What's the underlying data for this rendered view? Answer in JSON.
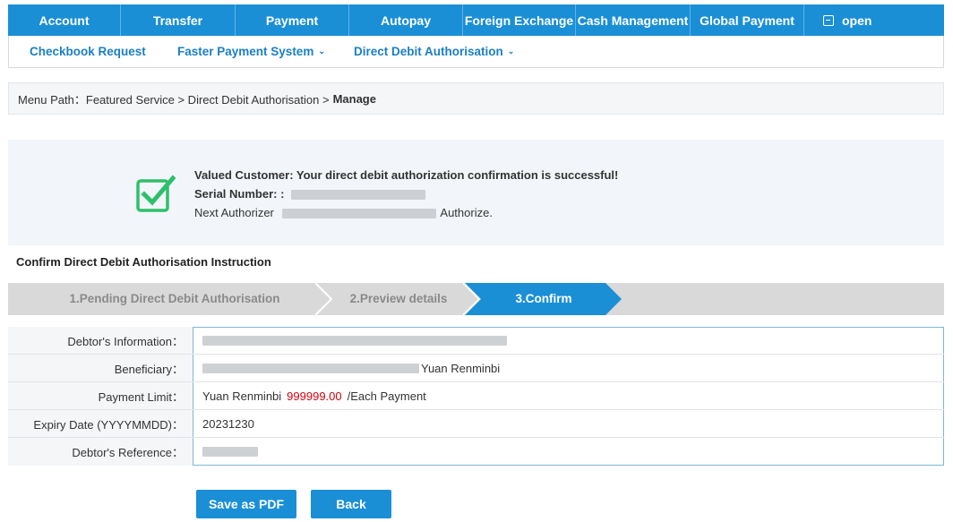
{
  "topnav": {
    "tabs": [
      "Account",
      "Transfer",
      "Payment",
      "Autopay",
      "Foreign Exchange",
      "Cash Management",
      "Global Payment"
    ],
    "open_label": "open"
  },
  "subnav": {
    "items": [
      "Checkbook Request",
      "Faster Payment System",
      "Direct Debit Authorisation"
    ]
  },
  "breadcrumb": {
    "prefix": "Menu Path：Featured Service > Direct Debit Authorisation >",
    "current": "Manage"
  },
  "success": {
    "message": "Valued Customer: Your direct debit authorization confirmation is successful!",
    "serial_label": "Serial Number: :",
    "next_authorizer_label": "Next Authorizer",
    "authorize_suffix": "Authorize."
  },
  "section_title": "Confirm Direct Debit Authorisation Instruction",
  "steps": [
    {
      "label": "1.Pending Direct Debit Authorisation",
      "state": "done"
    },
    {
      "label": "2.Preview details",
      "state": "done"
    },
    {
      "label": "3.Confirm",
      "state": "active"
    }
  ],
  "details": {
    "debtor_info_label": "Debtor's Information：",
    "beneficiary_label": "Beneficiary：",
    "beneficiary_suffix": "Yuan Renminbi",
    "payment_limit_label": "Payment Limit：",
    "payment_limit_currency": "Yuan Renminbi",
    "payment_limit_amount": "999999.00",
    "payment_limit_suffix": "/Each Payment",
    "expiry_label": "Expiry Date (YYYYMMDD)：",
    "expiry_value": "20231230",
    "reference_label": "Debtor's Reference："
  },
  "buttons": {
    "save_pdf": "Save as PDF",
    "back": "Back"
  },
  "colors": {
    "brand_blue": "#1a8fd6",
    "link_blue": "#1a7fc4",
    "success_green": "#2fbf6b",
    "amount_red": "#d4000f",
    "step_inactive": "#d9d9d9"
  },
  "icons": {
    "success": "check-square-icon",
    "open": "minus-square-icon",
    "dropdown": "chevron-down-icon"
  }
}
